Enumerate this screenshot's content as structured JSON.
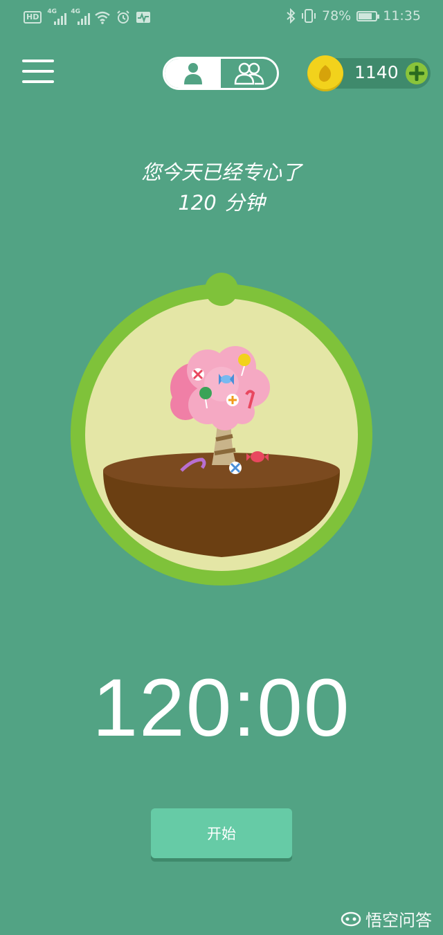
{
  "status_bar": {
    "hd": "HD",
    "net1": "4G",
    "net2": "4G",
    "battery_percent": "78%",
    "battery_level": 0.78,
    "time": "11:35"
  },
  "header": {
    "coins": "1140"
  },
  "focus": {
    "line1": "您今天已经专心了",
    "minutes": "120",
    "unit": "分钟"
  },
  "timer": {
    "value": "120:00"
  },
  "start_label": "开始",
  "watermark": "悟空问答",
  "colors": {
    "background": "#52a384",
    "ring": "#7fc23a",
    "ring_fill": "#e4e6a6",
    "soil_top": "#7b4a1f",
    "soil": "#6b3f12",
    "canopy": "#f5a9c3",
    "button": "#66cba6",
    "coin": "#f2d21c"
  }
}
